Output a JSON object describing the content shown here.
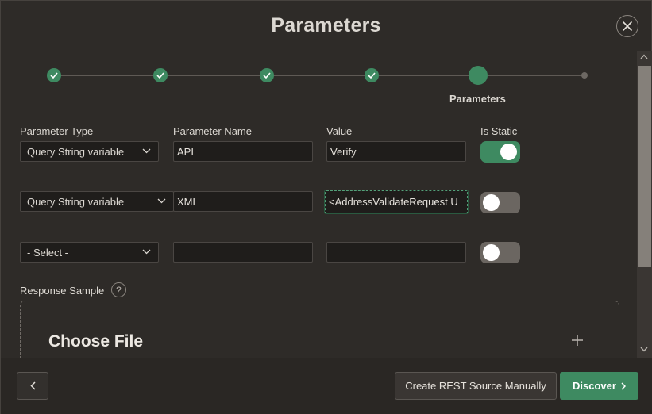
{
  "dialog": {
    "title": "Parameters"
  },
  "wizard": {
    "current_step_label": "Parameters",
    "steps": [
      {
        "state": "complete"
      },
      {
        "state": "complete"
      },
      {
        "state": "complete"
      },
      {
        "state": "complete"
      },
      {
        "state": "current"
      },
      {
        "state": "future"
      }
    ]
  },
  "columns": {
    "type": "Parameter Type",
    "name": "Parameter Name",
    "value": "Value",
    "static": "Is Static"
  },
  "rows": [
    {
      "type": "Query String variable",
      "name": "API",
      "value": "Verify",
      "is_static": true
    },
    {
      "type": "Query String variable",
      "name": "XML",
      "value": "<AddressValidateRequest U",
      "is_static": false
    },
    {
      "type": "- Select -",
      "name": "",
      "value": "",
      "is_static": false
    }
  ],
  "response": {
    "label": "Response Sample",
    "help": "?",
    "choose_file": "Choose File"
  },
  "footer": {
    "manual_label": "Create REST Source Manually",
    "discover_label": "Discover"
  },
  "colors": {
    "accent": "#3e8a61",
    "background": "#2e2b28",
    "field": "#1f1d1b"
  },
  "icons": {
    "close": "close-icon",
    "check": "check-icon",
    "chevron": "chevron-down-icon",
    "help": "help-icon",
    "plus": "plus-icon",
    "back": "chevron-left-icon",
    "next": "chevron-right-icon"
  }
}
